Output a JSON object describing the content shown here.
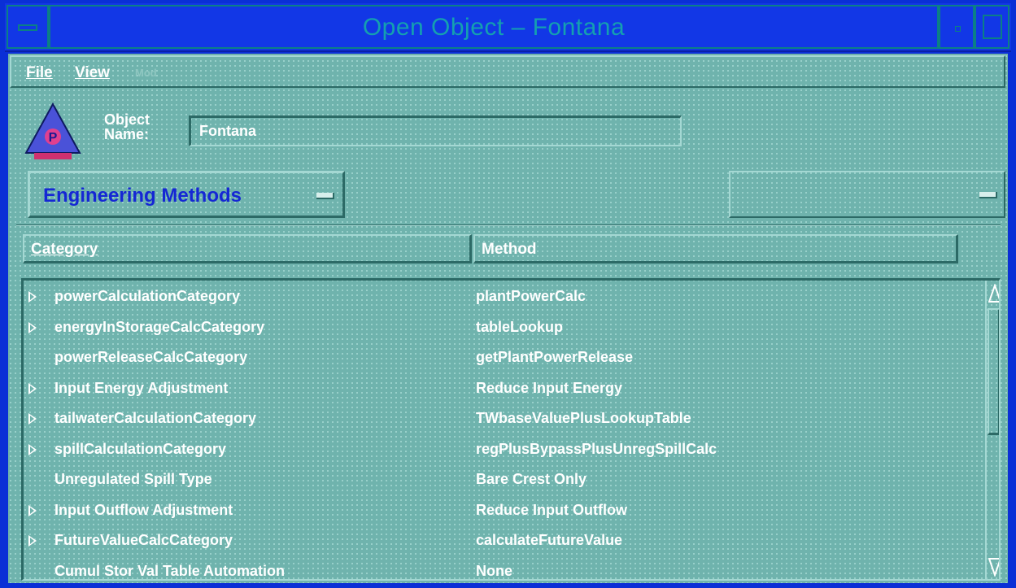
{
  "window": {
    "title": "Open Object – Fontana"
  },
  "menubar": {
    "file": "File",
    "view": "View",
    "modify": "Mod"
  },
  "object": {
    "name_label": "Object Name:",
    "name_value": "Fontana",
    "icon_letter": "P"
  },
  "view_selector": {
    "selected": "Engineering Methods"
  },
  "table": {
    "columns": [
      "Category",
      "Method"
    ],
    "rows": [
      {
        "category": "powerCalculationCategory",
        "method": "plantPowerCalc",
        "expandable": true
      },
      {
        "category": "energyInStorageCalcCategory",
        "method": "tableLookup",
        "expandable": true
      },
      {
        "category": "powerReleaseCalcCategory",
        "method": "getPlantPowerRelease",
        "expandable": false
      },
      {
        "category": "Input Energy Adjustment",
        "method": "Reduce Input Energy",
        "expandable": true
      },
      {
        "category": "tailwaterCalculationCategory",
        "method": "TWbaseValuePlusLookupTable",
        "expandable": true
      },
      {
        "category": "spillCalculationCategory",
        "method": "regPlusBypassPlusUnregSpillCalc",
        "expandable": true
      },
      {
        "category": "Unregulated Spill Type",
        "method": "Bare Crest Only",
        "expandable": false
      },
      {
        "category": "Input Outflow Adjustment",
        "method": "Reduce Input Outflow",
        "expandable": true
      },
      {
        "category": "FutureValueCalcCategory",
        "method": "calculateFutureValue",
        "expandable": true
      },
      {
        "category": "Cumul Stor Val Table Automation",
        "method": "None",
        "expandable": false
      }
    ]
  },
  "colors": {
    "background": "#6fb3ad",
    "titlebar": "#1237e6",
    "accent_text": "#1527d4",
    "icon_fill": "#4a52d8",
    "icon_base": "#d0306f"
  }
}
